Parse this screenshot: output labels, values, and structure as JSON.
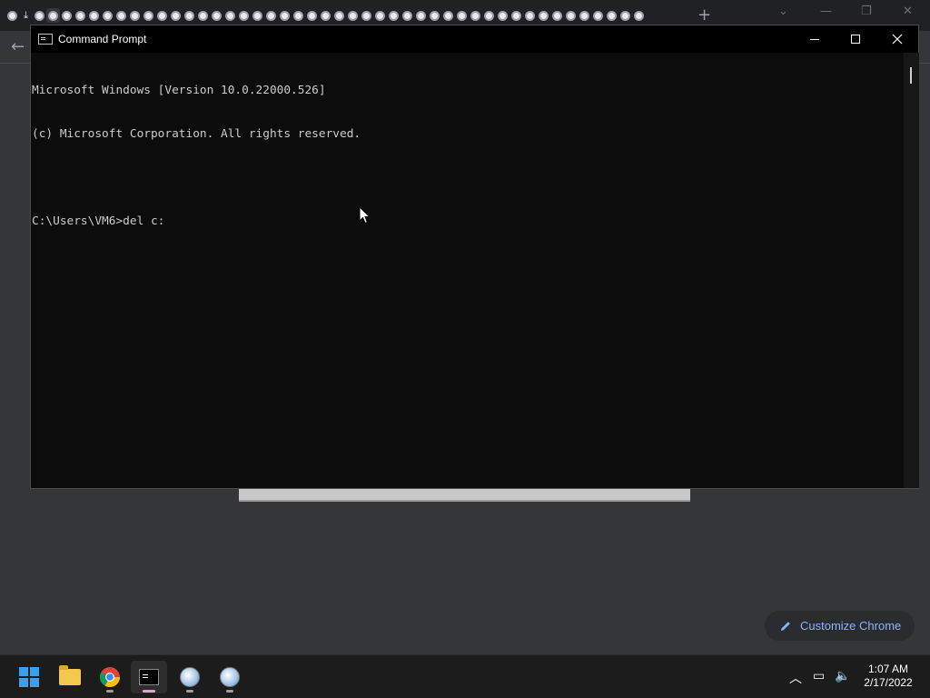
{
  "chrome": {
    "new_tab_label": "+",
    "tab_count": 47
  },
  "customize": {
    "label": "Customize Chrome"
  },
  "cmd": {
    "title": "Command Prompt",
    "lines": [
      "Microsoft Windows [Version 10.0.22000.526]",
      "(c) Microsoft Corporation. All rights reserved.",
      "",
      "C:\\Users\\VM6>del c:"
    ]
  },
  "taskbar": {
    "items": [
      "start-icon",
      "file-explorer-icon",
      "chrome-icon",
      "command-prompt-icon",
      "globe-app-icon",
      "globe-app-icon"
    ],
    "time": "1:07 AM",
    "date": "2/17/2022"
  },
  "colors": {
    "console_bg": "#0c0c0c",
    "console_text": "#cccccc",
    "accent": "#8ab4f8"
  }
}
